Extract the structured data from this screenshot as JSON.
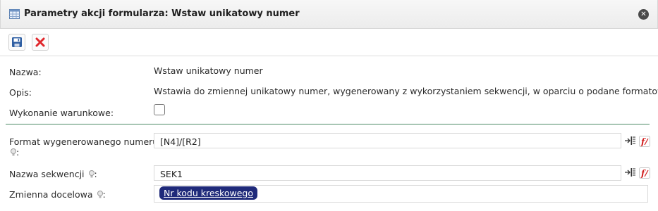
{
  "dialog": {
    "title": "Parametry akcji formularza: Wstaw unikatowy numer",
    "close_label": "✕"
  },
  "toolbar": {
    "save_icon": "save-icon",
    "delete_icon": "delete-icon"
  },
  "fields": {
    "name": {
      "label": "Nazwa:",
      "value": "Wstaw unikatowy numer"
    },
    "description": {
      "label": "Opis:",
      "value": "Wstawia do zmiennej unikatowy numer, wygenerowany z wykorzystaniem sekwencji, w oparciu o podane formatowanie."
    },
    "conditional": {
      "label": "Wykonanie warunkowe:",
      "checked": false
    },
    "format": {
      "label_line1": "Format wygenerowanego numeru",
      "label_line2": ":",
      "value": "[N4]/[R2]"
    },
    "sequence": {
      "label": "Nazwa sekwencji",
      "label_suffix": ":",
      "value": "SEK1"
    },
    "target": {
      "label": "Zmienna docelowa",
      "label_suffix": ":",
      "value": "Nr kodu kreskowego"
    }
  },
  "colors": {
    "separator": "#4b8a64",
    "tag_background": "#1f2a7a",
    "delete_red": "#e0262b",
    "save_blue": "#2f5fa3"
  }
}
